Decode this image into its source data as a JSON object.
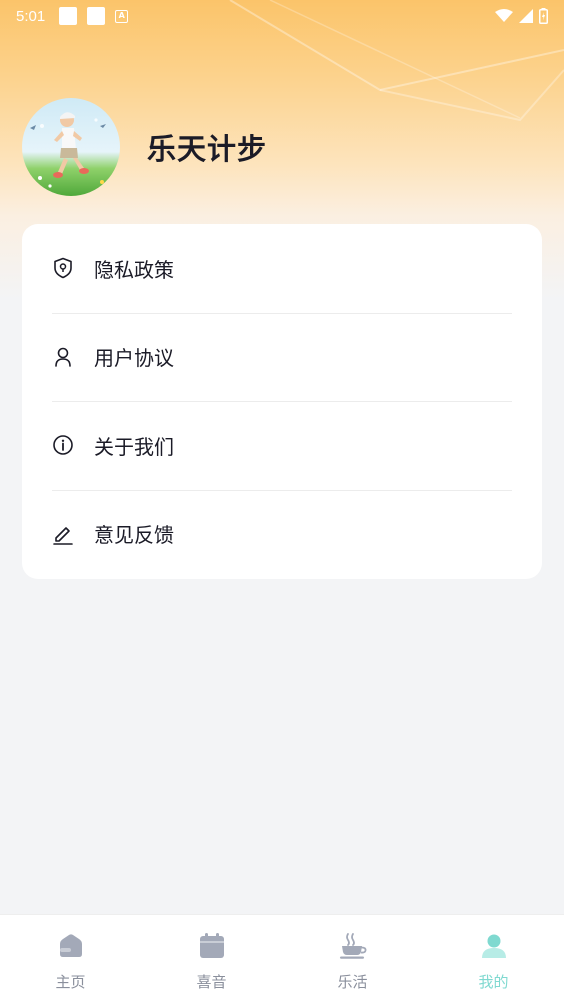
{
  "status_bar": {
    "time": "5:01"
  },
  "profile": {
    "app_name": "乐天计步"
  },
  "menu": {
    "items": [
      {
        "label": "隐私政策",
        "icon": "shield-icon"
      },
      {
        "label": "用户协议",
        "icon": "user-icon"
      },
      {
        "label": "关于我们",
        "icon": "info-icon"
      },
      {
        "label": "意见反馈",
        "icon": "edit-icon"
      }
    ]
  },
  "tabbar": {
    "items": [
      {
        "label": "主页",
        "icon": "home-icon",
        "active": false
      },
      {
        "label": "喜音",
        "icon": "calendar-icon",
        "active": false
      },
      {
        "label": "乐活",
        "icon": "coffee-cup-icon",
        "active": false
      },
      {
        "label": "我的",
        "icon": "profile-icon",
        "active": true
      }
    ]
  },
  "colors": {
    "header_gradient_top": "#fbc46a",
    "page_background": "#f3f4f6",
    "tab_active": "#7fd9d0",
    "tab_inactive": "#8a8f9c",
    "text_primary": "#1b1b27"
  }
}
